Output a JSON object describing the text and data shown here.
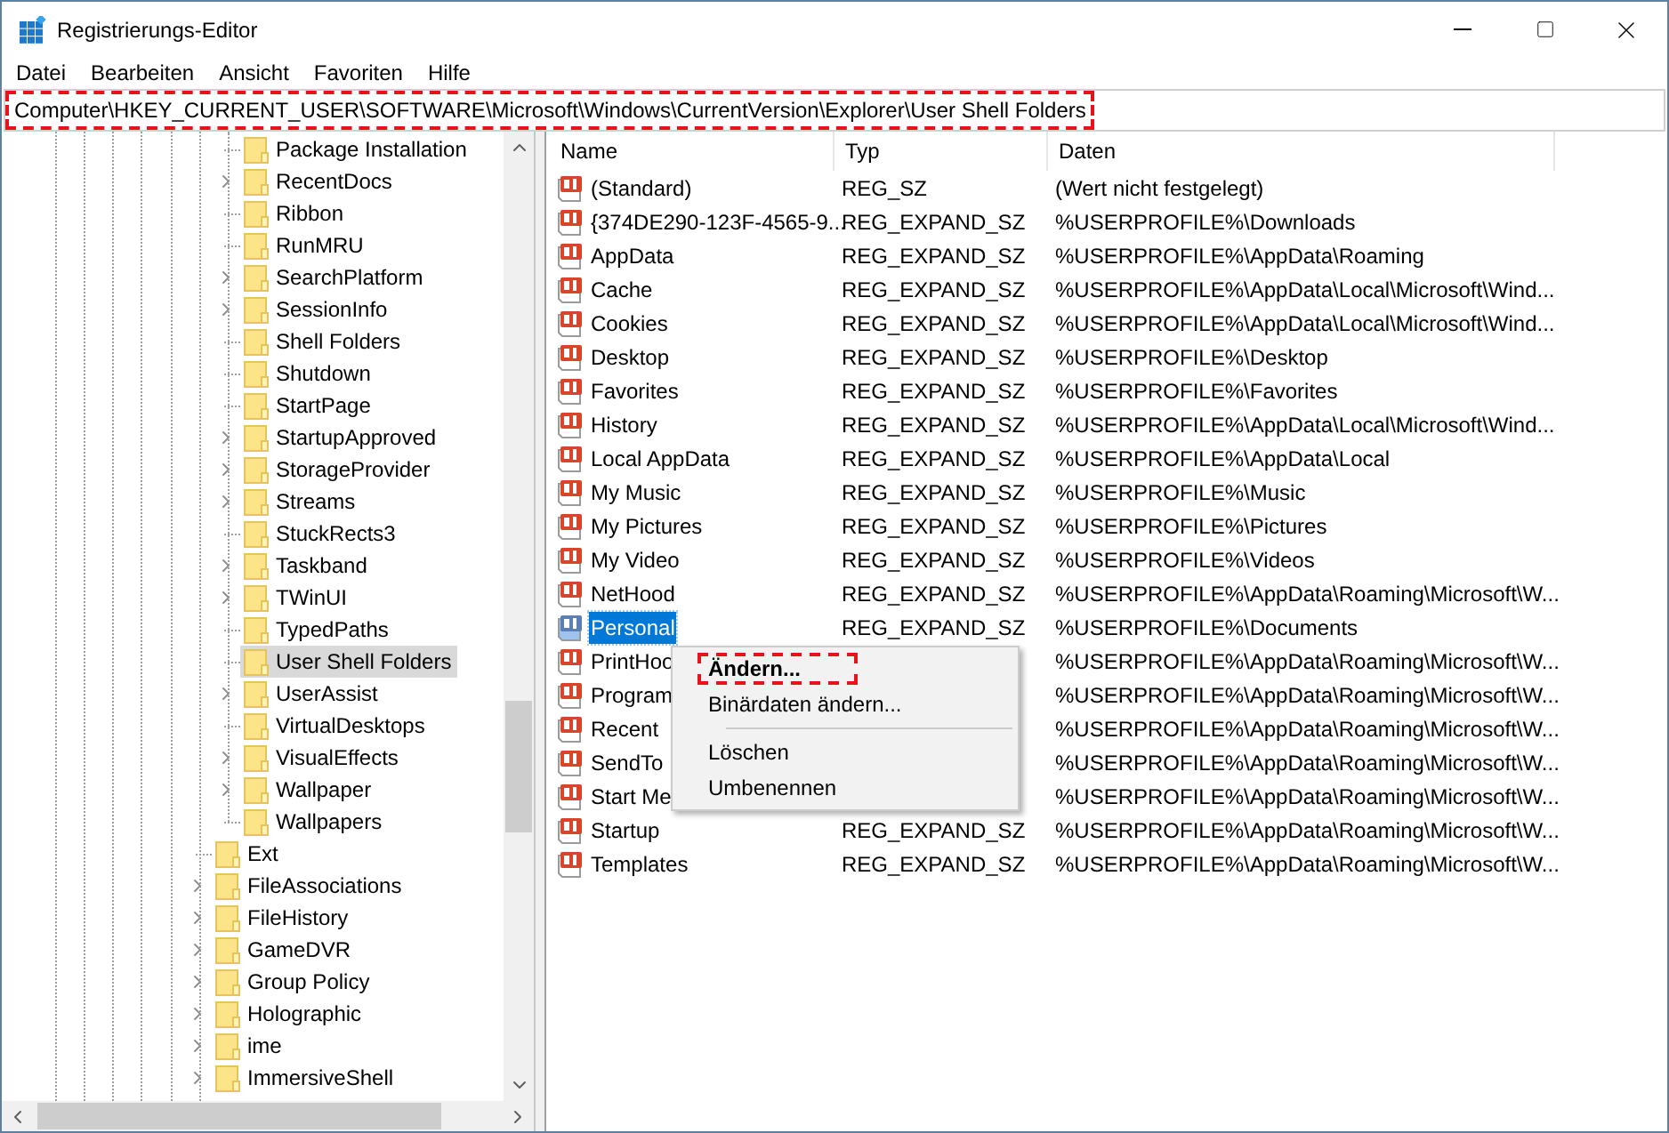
{
  "window": {
    "title": "Registrierungs-Editor"
  },
  "menu": [
    "Datei",
    "Bearbeiten",
    "Ansicht",
    "Favoriten",
    "Hilfe"
  ],
  "address_bar": {
    "value": "Computer\\HKEY_CURRENT_USER\\SOFTWARE\\Microsoft\\Windows\\CurrentVersion\\Explorer\\User Shell Folders",
    "highlighted": true
  },
  "tree": {
    "nested_items": [
      {
        "label": "Package Installation",
        "expandable": false,
        "selected": false
      },
      {
        "label": "RecentDocs",
        "expandable": true,
        "selected": false
      },
      {
        "label": "Ribbon",
        "expandable": false,
        "selected": false
      },
      {
        "label": "RunMRU",
        "expandable": false,
        "selected": false
      },
      {
        "label": "SearchPlatform",
        "expandable": true,
        "selected": false
      },
      {
        "label": "SessionInfo",
        "expandable": true,
        "selected": false
      },
      {
        "label": "Shell Folders",
        "expandable": false,
        "selected": false
      },
      {
        "label": "Shutdown",
        "expandable": false,
        "selected": false
      },
      {
        "label": "StartPage",
        "expandable": false,
        "selected": false
      },
      {
        "label": "StartupApproved",
        "expandable": true,
        "selected": false
      },
      {
        "label": "StorageProvider",
        "expandable": true,
        "selected": false
      },
      {
        "label": "Streams",
        "expandable": true,
        "selected": false
      },
      {
        "label": "StuckRects3",
        "expandable": false,
        "selected": false
      },
      {
        "label": "Taskband",
        "expandable": true,
        "selected": false
      },
      {
        "label": "TWinUI",
        "expandable": true,
        "selected": false
      },
      {
        "label": "TypedPaths",
        "expandable": false,
        "selected": false
      },
      {
        "label": "User Shell Folders",
        "expandable": false,
        "selected": true
      },
      {
        "label": "UserAssist",
        "expandable": true,
        "selected": false
      },
      {
        "label": "VirtualDesktops",
        "expandable": false,
        "selected": false
      },
      {
        "label": "VisualEffects",
        "expandable": true,
        "selected": false
      },
      {
        "label": "Wallpaper",
        "expandable": true,
        "selected": false
      },
      {
        "label": "Wallpapers",
        "expandable": false,
        "selected": false
      }
    ],
    "items": [
      {
        "label": "Ext",
        "expandable": false,
        "selected": false
      },
      {
        "label": "FileAssociations",
        "expandable": true,
        "selected": false
      },
      {
        "label": "FileHistory",
        "expandable": true,
        "selected": false
      },
      {
        "label": "GameDVR",
        "expandable": true,
        "selected": false
      },
      {
        "label": "Group Policy",
        "expandable": true,
        "selected": false
      },
      {
        "label": "Holographic",
        "expandable": true,
        "selected": false
      },
      {
        "label": "ime",
        "expandable": true,
        "selected": false
      },
      {
        "label": "ImmersiveShell",
        "expandable": true,
        "selected": false
      }
    ]
  },
  "table": {
    "columns": [
      "Name",
      "Typ",
      "Daten"
    ],
    "rows": [
      {
        "name": "(Standard)",
        "type": "REG_SZ",
        "data": "(Wert nicht festgelegt)",
        "selected": false
      },
      {
        "name": "{374DE290-123F-4565-9...",
        "type": "REG_EXPAND_SZ",
        "data": "%USERPROFILE%\\Downloads",
        "selected": false
      },
      {
        "name": "AppData",
        "type": "REG_EXPAND_SZ",
        "data": "%USERPROFILE%\\AppData\\Roaming",
        "selected": false
      },
      {
        "name": "Cache",
        "type": "REG_EXPAND_SZ",
        "data": "%USERPROFILE%\\AppData\\Local\\Microsoft\\Wind...",
        "selected": false
      },
      {
        "name": "Cookies",
        "type": "REG_EXPAND_SZ",
        "data": "%USERPROFILE%\\AppData\\Local\\Microsoft\\Wind...",
        "selected": false
      },
      {
        "name": "Desktop",
        "type": "REG_EXPAND_SZ",
        "data": "%USERPROFILE%\\Desktop",
        "selected": false
      },
      {
        "name": "Favorites",
        "type": "REG_EXPAND_SZ",
        "data": "%USERPROFILE%\\Favorites",
        "selected": false
      },
      {
        "name": "History",
        "type": "REG_EXPAND_SZ",
        "data": "%USERPROFILE%\\AppData\\Local\\Microsoft\\Wind...",
        "selected": false
      },
      {
        "name": "Local AppData",
        "type": "REG_EXPAND_SZ",
        "data": "%USERPROFILE%\\AppData\\Local",
        "selected": false
      },
      {
        "name": "My Music",
        "type": "REG_EXPAND_SZ",
        "data": "%USERPROFILE%\\Music",
        "selected": false
      },
      {
        "name": "My Pictures",
        "type": "REG_EXPAND_SZ",
        "data": "%USERPROFILE%\\Pictures",
        "selected": false
      },
      {
        "name": "My Video",
        "type": "REG_EXPAND_SZ",
        "data": "%USERPROFILE%\\Videos",
        "selected": false
      },
      {
        "name": "NetHood",
        "type": "REG_EXPAND_SZ",
        "data": "%USERPROFILE%\\AppData\\Roaming\\Microsoft\\W...",
        "selected": false
      },
      {
        "name": "Personal",
        "type": "REG_EXPAND_SZ",
        "data": "%USERPROFILE%\\Documents",
        "selected": true
      },
      {
        "name": "PrintHoo",
        "data": "%USERPROFILE%\\AppData\\Roaming\\Microsoft\\W...",
        "selected": false
      },
      {
        "name": "Program",
        "data": "%USERPROFILE%\\AppData\\Roaming\\Microsoft\\W...",
        "selected": false
      },
      {
        "name": "Recent",
        "data": "%USERPROFILE%\\AppData\\Roaming\\Microsoft\\W...",
        "selected": false
      },
      {
        "name": "SendTo",
        "data": "%USERPROFILE%\\AppData\\Roaming\\Microsoft\\W...",
        "selected": false
      },
      {
        "name": "Start Me",
        "data": "%USERPROFILE%\\AppData\\Roaming\\Microsoft\\W...",
        "selected": false
      },
      {
        "name": "Startup",
        "type": "REG_EXPAND_SZ",
        "data": "%USERPROFILE%\\AppData\\Roaming\\Microsoft\\W...",
        "selected": false
      },
      {
        "name": "Templates",
        "type": "REG_EXPAND_SZ",
        "data": "%USERPROFILE%\\AppData\\Roaming\\Microsoft\\W...",
        "selected": false
      }
    ]
  },
  "context_menu": [
    {
      "kind": "item",
      "label": "Ändern...",
      "bold": true,
      "highlighted": true
    },
    {
      "kind": "item",
      "label": "Binärdaten ändern...",
      "bold": false,
      "highlighted": false
    },
    {
      "kind": "separator"
    },
    {
      "kind": "item",
      "label": "Löschen",
      "bold": false,
      "highlighted": false
    },
    {
      "kind": "item",
      "label": "Umbenennen",
      "bold": false,
      "highlighted": false
    }
  ]
}
